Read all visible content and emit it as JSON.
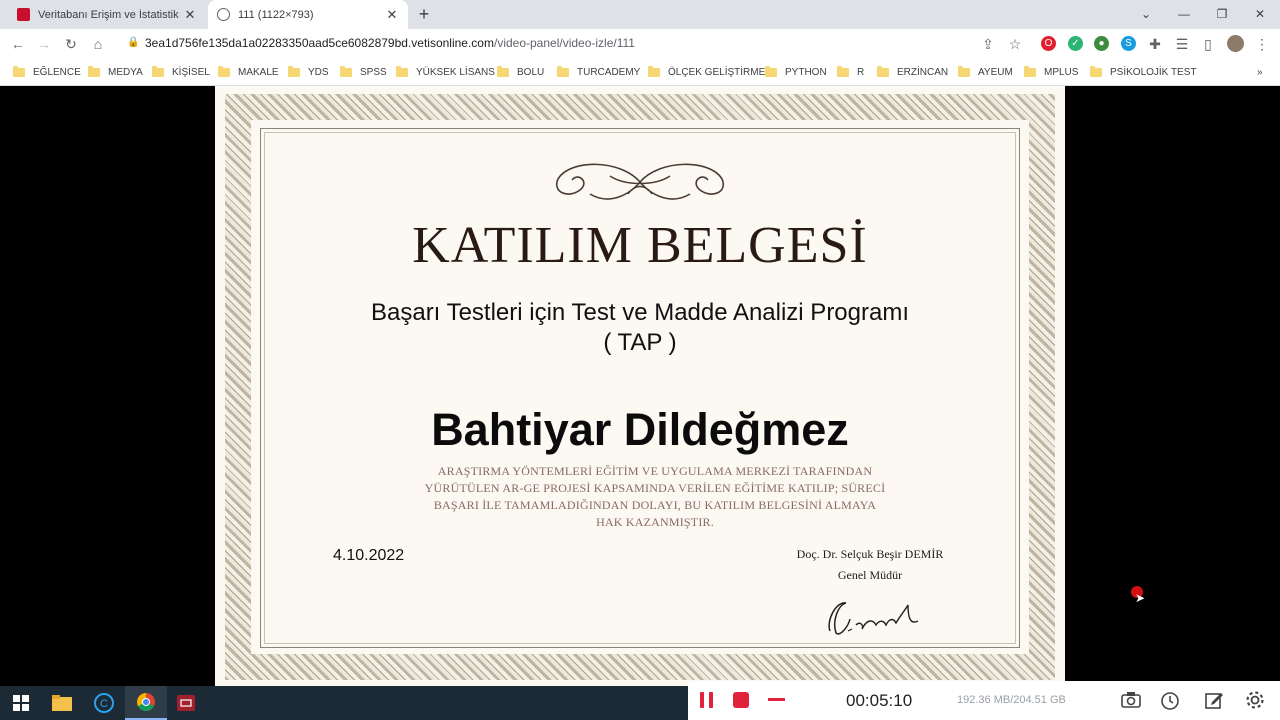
{
  "browser": {
    "tabs": [
      {
        "title": "Veritabanı Erişim ve İstatistik Sistemi",
        "active": false
      },
      {
        "title": "111 (1122×793)",
        "active": true
      }
    ],
    "url": {
      "host": "3ea1d756fe135da1a02283350aad5ce6082879bd.vetisonline.com",
      "path": "/video-panel/video-izle/111"
    },
    "bookmarks": [
      "EĞLENCE",
      "MEDYA",
      "KİŞİSEL",
      "MAKALE",
      "YDS",
      "SPSS",
      "YÜKSEK LİSANS",
      "BOLU",
      "TURCADEMY",
      "ÖLÇEK GELİŞTİRME",
      "PYTHON",
      "R",
      "ERZİNCAN",
      "AYEUM",
      "MPLUS",
      "PSİKOLOJİK TEST"
    ],
    "bookmarks_overflow": "»"
  },
  "certificate": {
    "title": "KATILIM BELGESİ",
    "program_line1": "Başarı Testleri için Test ve Madde Analizi Programı",
    "program_line2": "( TAP )",
    "recipient": "Bahtiyar Dildeğmez",
    "statement_lines": [
      "ARAŞTIRMA YÖNTEMLERİ EĞİTİM VE UYGULAMA MERKEZİ TARAFINDAN",
      "YÜRÜTÜLEN AR-GE PROJESİ KAPSAMINDA VERİLEN EĞİTİME KATILIP; SÜRECİ",
      "BAŞARI İLE TAMAMLADIĞINDAN DOLAYI, BU KATILIM BELGESİNİ ALMAYA",
      "HAK KAZANMIŞTIR."
    ],
    "date": "4.10.2022",
    "signer_name": "Doç. Dr. Selçuk Beşir DEMİR",
    "signer_title": "Genel Müdür"
  },
  "recorder": {
    "elapsed": "00:05:10",
    "storage": "192.36 MB/204.51 GB"
  },
  "colors": {
    "record_red": "#e0223a",
    "taskbar": "#1b2a34",
    "cert_bg": "#fbf9f1"
  }
}
